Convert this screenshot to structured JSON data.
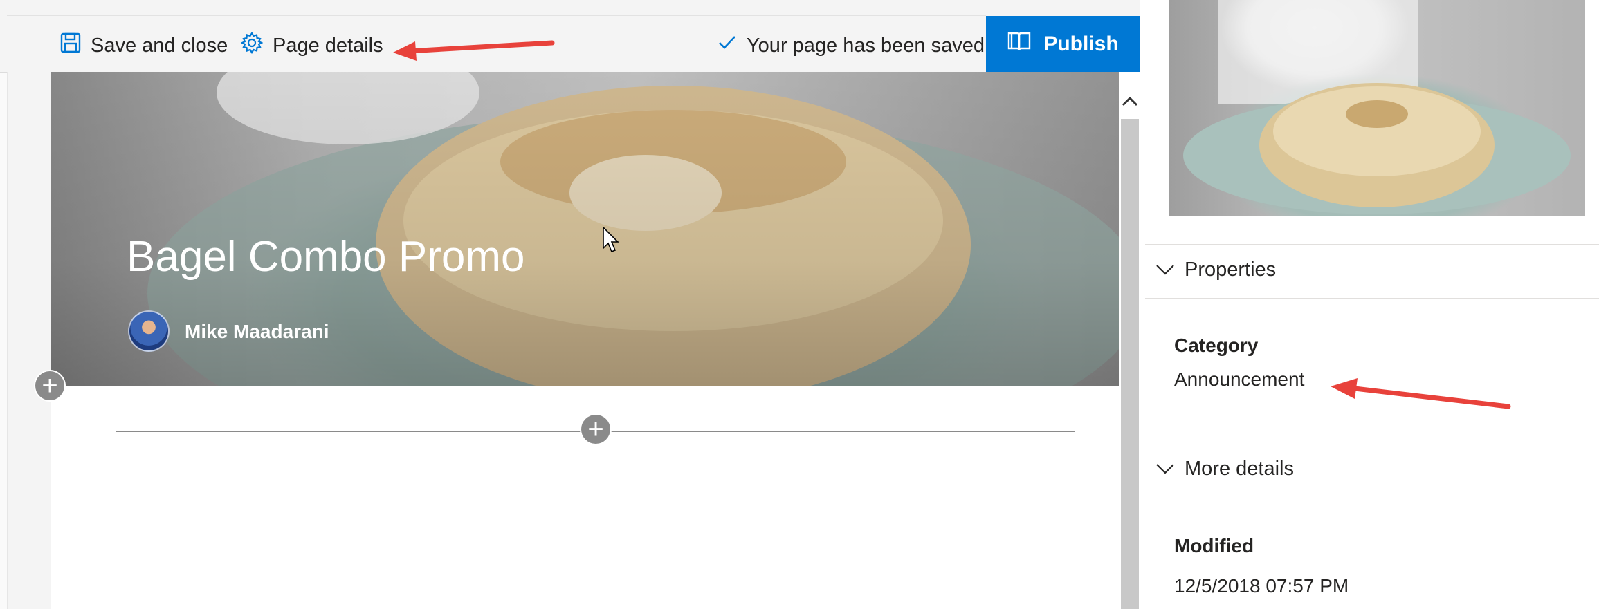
{
  "toolbar": {
    "save_label": "Save and close",
    "page_details_label": "Page details",
    "saved_status": "Your page has been saved",
    "publish_label": "Publish"
  },
  "hero": {
    "title": "Bagel Combo Promo",
    "author": "Mike Maadarani"
  },
  "details_pane": {
    "properties_header": "Properties",
    "category_label": "Category",
    "category_value": "Announcement",
    "more_details_header": "More details",
    "modified_label": "Modified",
    "modified_value": "12/5/2018 07:57 PM"
  },
  "colors": {
    "accent": "#0078d4",
    "annotation_arrow": "#e8423b"
  },
  "icons": [
    "save-icon",
    "gear-icon",
    "checkmark-icon",
    "book-icon",
    "plus-icon",
    "chevron-up-icon",
    "chevron-down-icon",
    "mouse-cursor-icon"
  ]
}
